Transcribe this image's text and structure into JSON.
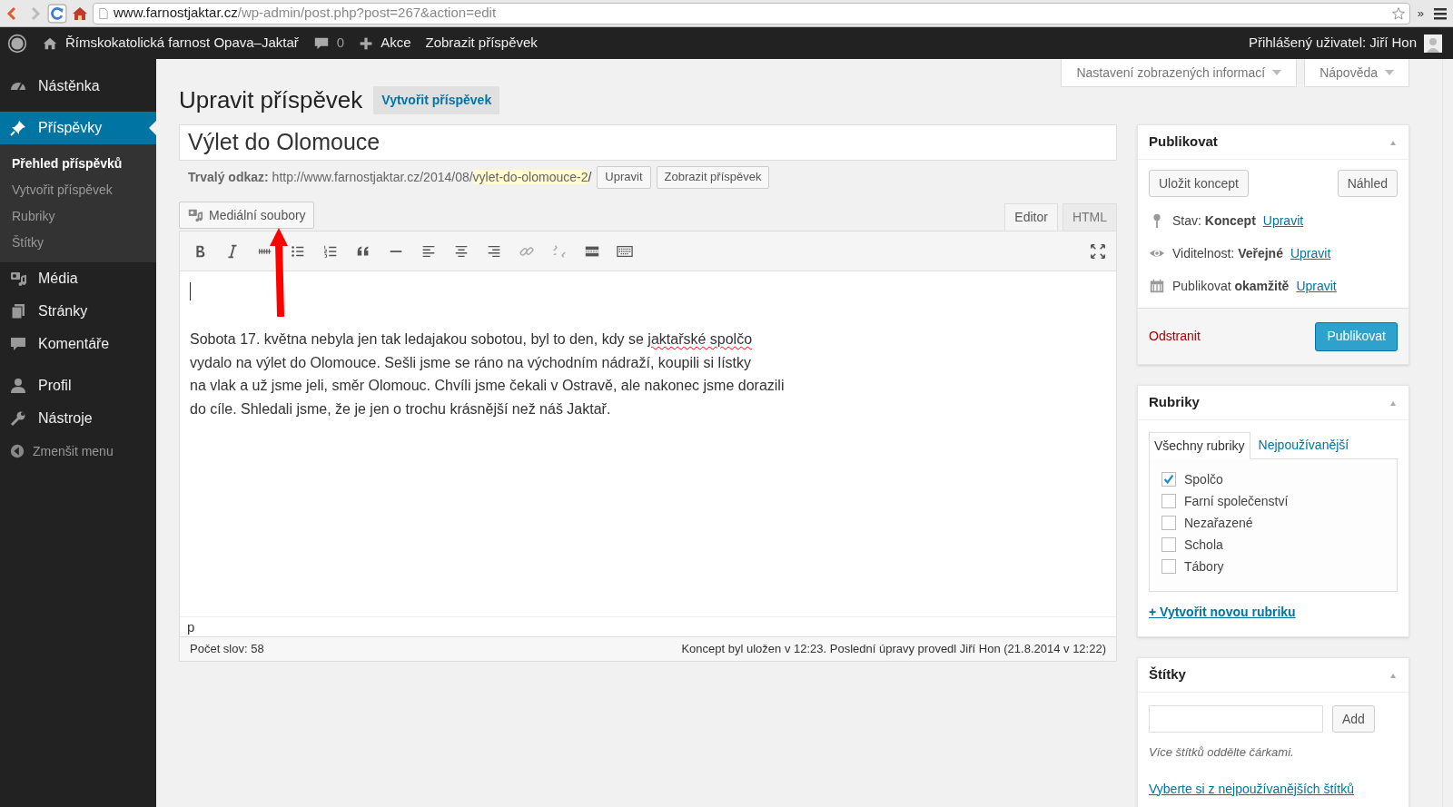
{
  "browser": {
    "url_host": "www.farnostjaktar.cz",
    "url_path": "/wp-admin/post.php?post=267&action=edit",
    "overflow": "»"
  },
  "admin_bar": {
    "site_name": "Římskokatolická farnost Opava–Jaktař",
    "comments": "0",
    "new": "Akce",
    "view": "Zobrazit příspěvek",
    "user": "Přihlášený uživatel: Jiří Hon"
  },
  "sidebar": {
    "menu_groups": [
      [
        {
          "kind": "dashboard",
          "label": "Nástěnka",
          "selected": false
        }
      ],
      [
        {
          "kind": "pin",
          "label": "Příspěvky",
          "selected": true,
          "children": [
            {
              "label": "Přehled příspěvků",
              "selected": true
            },
            {
              "label": "Vytvořit příspěvek",
              "selected": false
            },
            {
              "label": "Rubriky",
              "selected": false
            },
            {
              "label": "Štítky",
              "selected": false
            }
          ]
        },
        {
          "kind": "media",
          "label": "Média",
          "selected": false
        },
        {
          "kind": "pages",
          "label": "Stránky",
          "selected": false
        },
        {
          "kind": "comments",
          "label": "Komentáře",
          "selected": false
        }
      ],
      [
        {
          "kind": "user",
          "label": "Profil",
          "selected": false
        },
        {
          "kind": "tools",
          "label": "Nástroje",
          "selected": false
        }
      ]
    ],
    "collapse": "Zmenšit menu"
  },
  "screen_tabs": [
    "Nastavení zobrazených informací",
    "Nápověda"
  ],
  "heading": "Upravit příspěvek",
  "add_new": "Vytvořit příspěvek",
  "post_title": "Výlet do Olomouce",
  "permalink": {
    "label": "Trvalý odkaz:",
    "base": "http://www.farnostjaktar.cz/2014/08/",
    "slug": "vylet-do-olomouce-2",
    "end": "/",
    "buttons": [
      "Upravit",
      "Zobrazit příspěvek"
    ]
  },
  "media_button": "Mediální soubory",
  "editor_tabs": [
    {
      "label": "Editor",
      "selected": true
    },
    {
      "label": "HTML",
      "selected": false
    }
  ],
  "content_lines": [
    [
      {
        "text": "Sobota 17. května nebyla jen tak ledajakou sobotou, byl to den, kdy se ",
        "misspelled": false
      },
      {
        "text": "jaktařské spolčo",
        "misspelled": true
      }
    ],
    [
      {
        "text": "vydalo na výlet do Olomouce. Sešli jsme se ráno na východním nádraží, koupili si lístky",
        "misspelled": false
      }
    ],
    [
      {
        "text": "na vlak a už jsme jeli, směr Olomouc. Chvíli jsme čekali v Ostravě, ale nakonec jsme dorazili",
        "misspelled": false
      }
    ],
    [
      {
        "text": "do cíle. Shledali jsme, že je jen o trochu krásnější než náš Jaktař.",
        "misspelled": false
      }
    ]
  ],
  "path": "p",
  "word_count": "Počet slov: 58",
  "autosave": "Koncept byl uložen v 12:23. Poslední úpravy provedl Jiří Hon (21.8.2014 v 12:22)",
  "publish": {
    "title": "Publikovat",
    "save": "Uložit koncept",
    "preview": "Náhled",
    "rows": [
      {
        "kind": "status",
        "label": "Stav:",
        "value": "Koncept",
        "link": "Upravit"
      },
      {
        "kind": "visibility",
        "label": "Viditelnost:",
        "value": "Veřejné",
        "link": "Upravit"
      },
      {
        "kind": "schedule",
        "label": "Publikovat",
        "value": "okamžitě",
        "link": "Upravit"
      }
    ],
    "delete": "Odstranit",
    "submit": "Publikovat"
  },
  "categories": {
    "title": "Rubriky",
    "tabs": [
      {
        "label": "Všechny rubriky",
        "selected": true
      },
      {
        "label": "Nejpoužívanější",
        "selected": false
      }
    ],
    "items": [
      {
        "label": "Spolčo",
        "checked": true
      },
      {
        "label": "Farní společenství",
        "checked": false
      },
      {
        "label": "Nezařazené",
        "checked": false
      },
      {
        "label": "Schola",
        "checked": false
      },
      {
        "label": "Tábory",
        "checked": false
      }
    ],
    "add_link": "+ Vytvořit novou rubriku"
  },
  "tags": {
    "title": "Štítky",
    "add": "Add",
    "hint": "Více štítků oddělte čárkami.",
    "link": "Vyberte si z nejpoužívanějších štítků"
  }
}
